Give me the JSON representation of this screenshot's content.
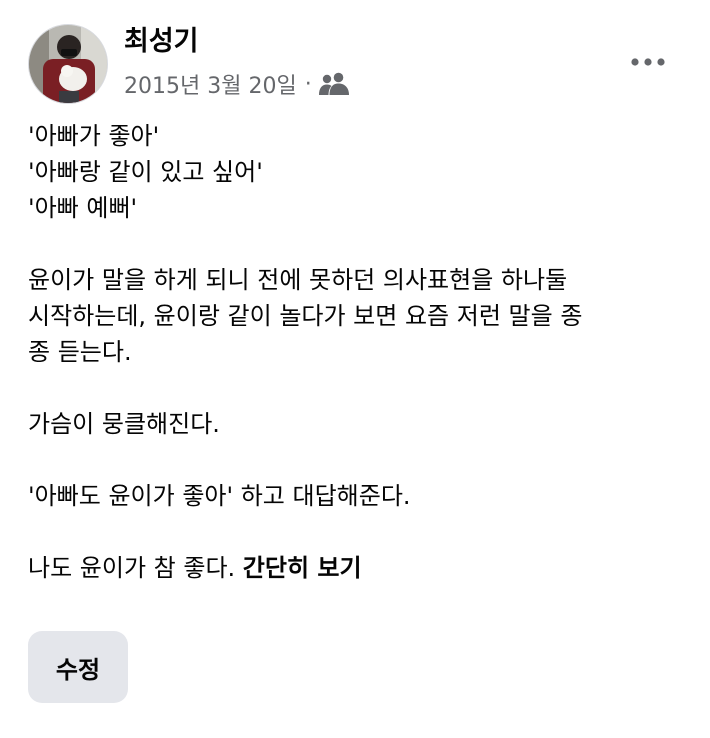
{
  "post": {
    "author": "최성기",
    "date": "2015년 3월 20일",
    "separator": "·",
    "audience_icon": "friends-icon",
    "more_icon": "more-options-icon",
    "lines": [
      "'아빠가 좋아'",
      "'아빠랑 같이 있고 싶어'",
      "'아빠 예뻐'",
      "",
      "윤이가 말을 하게 되니 전에 못하던 의사표현을 하나둘",
      "시작하는데, 윤이랑 같이 놀다가 보면 요즘 저런 말을 종",
      "종 듣는다.",
      "",
      "가슴이 뭉클해진다.",
      "",
      "'아빠도 윤이가 좋아' 하고 대답해준다.",
      "",
      "나도 윤이가 참 좋다."
    ],
    "see_less": "간단히 보기",
    "edit_label": "수정"
  },
  "colors": {
    "text_primary": "#050505",
    "text_secondary": "#65676b",
    "button_bg": "#e4e6eb"
  }
}
